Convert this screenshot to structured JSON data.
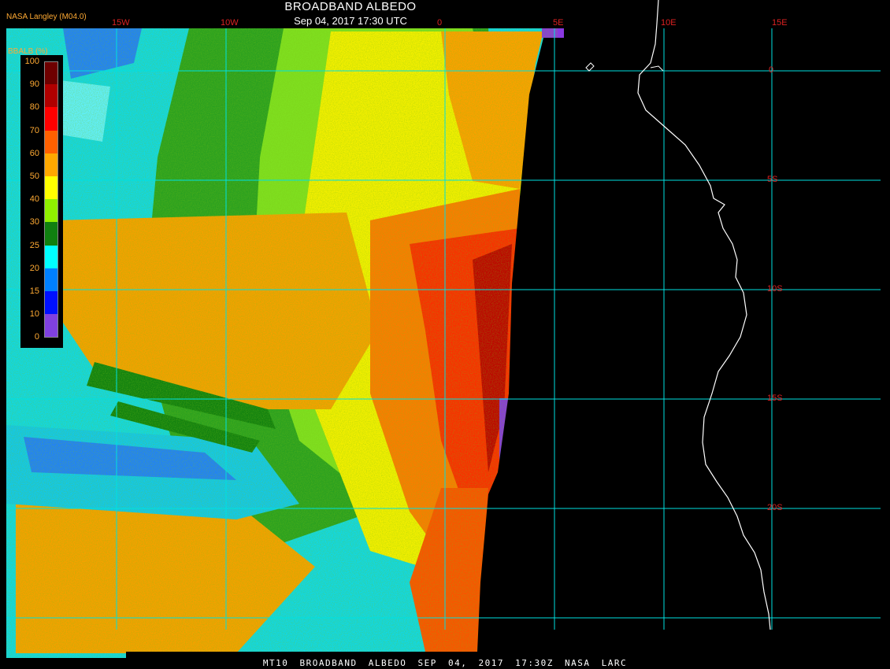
{
  "header": {
    "title": "BROADBAND ALBEDO",
    "subtitle": "Sep 04, 2017 17:30 UTC",
    "credit": "NASA Langley (M04.0)"
  },
  "footer": {
    "text": "MT10 BROADBAND ALBEDO SEP 04, 2017 17:30Z NASA LARC"
  },
  "legend": {
    "title": "BBALB (%)",
    "ticks": [
      "100",
      "90",
      "80",
      "70",
      "60",
      "50",
      "40",
      "30",
      "25",
      "20",
      "15",
      "10",
      "0"
    ],
    "colors": [
      "#6e0000",
      "#b00000",
      "#ff0000",
      "#ff6000",
      "#ffa800",
      "#ffff00",
      "#90f000",
      "#108010",
      "#00ffff",
      "#0080ff",
      "#0010ff",
      "#8040e0"
    ]
  },
  "gridlines": {
    "longitude_labels": [
      "15W",
      "10W",
      "0",
      "5E",
      "10E",
      "15E"
    ],
    "latitude_labels": [
      "0",
      "5S",
      "10S",
      "15S",
      "20S"
    ],
    "color": "#00e0e0",
    "label_color": "#dd2222"
  },
  "map": {
    "background": "#000000",
    "coastline_color": "#ffffff"
  }
}
